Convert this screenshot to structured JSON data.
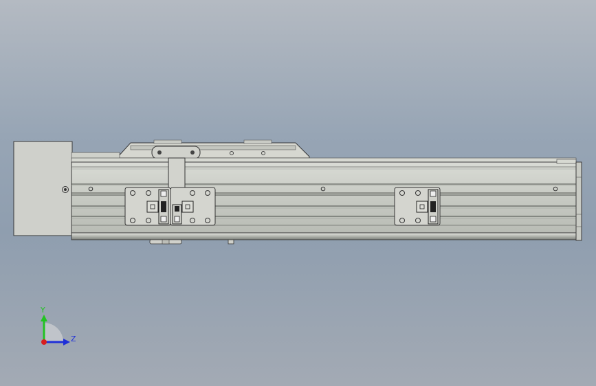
{
  "viewport": {
    "background": "#97a5b5",
    "model": "linear-actuator-side-view"
  },
  "triad": {
    "y_label": "Y",
    "z_label": "Z",
    "y_color": "#22c322",
    "z_color": "#1e2fd8",
    "origin_color": "#d81e1e"
  }
}
